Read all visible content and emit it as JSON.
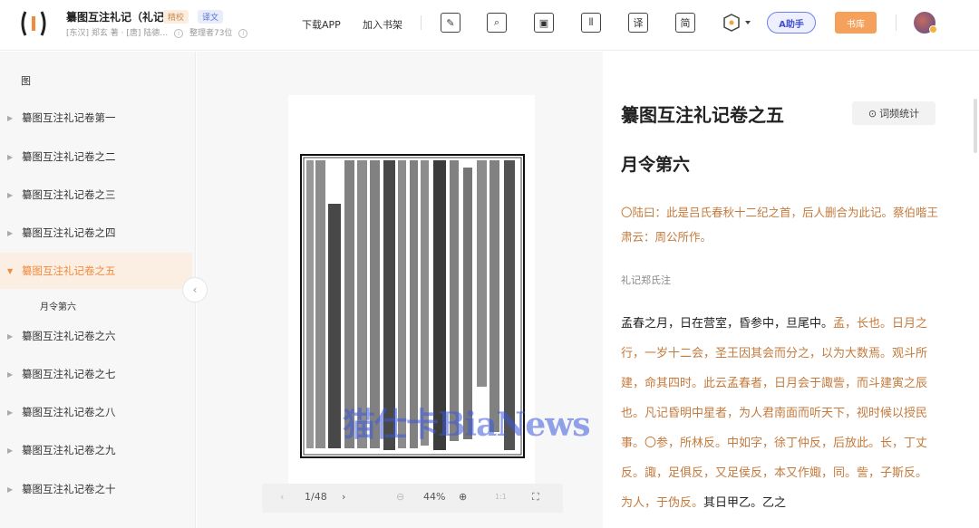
{
  "header": {
    "book_title": "纂图互注礼记（礼记）",
    "badge_jingxiao": "精校",
    "badge_yiwen": "译文",
    "meta_authors": "[东汉] 郑玄 著 · [唐] 陆德…",
    "meta_editors": "整理者73位",
    "download_app": "下载APP",
    "add_shelf": "加入书架",
    "btn_note": "✎",
    "btn_search": "⌕",
    "btn_image": "▣",
    "btn_columns": "⫴",
    "btn_translate": "译",
    "btn_simplified": "简",
    "ai_label": "A助手",
    "library": "书库"
  },
  "sidebar": {
    "heading": "图",
    "items": [
      {
        "label": "纂图互注礼记卷第一"
      },
      {
        "label": "纂图互注礼记卷之二"
      },
      {
        "label": "纂图互注礼记卷之三"
      },
      {
        "label": "纂图互注礼记卷之四"
      },
      {
        "label": "纂图互注礼记卷之五"
      },
      {
        "label": "纂图互注礼记卷之六"
      },
      {
        "label": "纂图互注礼记卷之七"
      },
      {
        "label": "纂图互注礼记卷之八"
      },
      {
        "label": "纂图互注礼记卷之九"
      },
      {
        "label": "纂图互注礼记卷之十"
      }
    ],
    "sub_item": "月令第六",
    "active_index": 4
  },
  "viewer": {
    "page_indicator": "1/48",
    "zoom": "44%",
    "fit_label": "1:1",
    "watermark": "猫仕卡BiaNews"
  },
  "content": {
    "title": "纂图互注礼记卷之五",
    "word_freq_btn": "词频统计",
    "subtitle": "月令第六",
    "note": "〇陆曰：此是吕氏春秋十二纪之首，后人删合为此记。蔡伯喈王肃云：周公所作。",
    "label": "礼记郑氏注",
    "body_main": "孟春之月，日在营室，昏参中，旦尾中。",
    "body_comment": "孟，长也。日月之行，一岁十二会，圣王因其会而分之，以为大数焉。观斗所建，命其四时。此云孟春者，日月会于諏訾，而斗建寅之辰也。凡记昏明中星者，为人君南面而听天下，视时候以授民事。〇参，所林反。中如字，徐丁仲反，后放此。长，丁丈反。諏，足俱反，又足侯反，本又作娵，同。訾，子斯反。为人，于伪反。",
    "body_tail": "其日甲乙。乙之"
  }
}
